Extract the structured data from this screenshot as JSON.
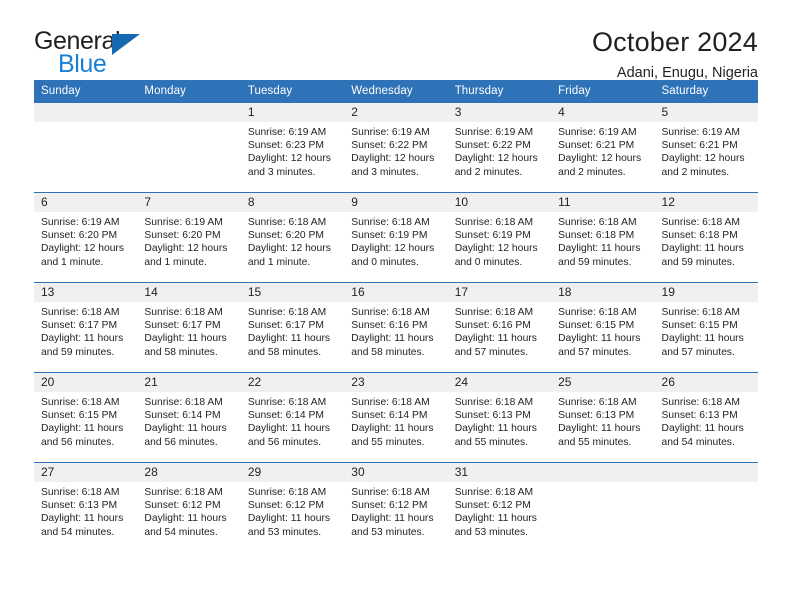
{
  "brand": {
    "name_top": "General",
    "name_bottom": "Blue",
    "triangle_color": "#1668B0",
    "blue_color": "#1B7FD4"
  },
  "header": {
    "title": "October 2024",
    "subtitle": "Adani, Enugu, Nigeria",
    "header_bg": "#2E72B8",
    "date_strip_bg": "#F0F0F0"
  },
  "weekday_headers": [
    "Sunday",
    "Monday",
    "Tuesday",
    "Wednesday",
    "Thursday",
    "Friday",
    "Saturday"
  ],
  "labels": {
    "sunrise_prefix": "Sunrise:",
    "sunset_prefix": "Sunset:",
    "daylight_prefix": "Daylight:"
  },
  "weeks": [
    [
      {
        "date": "",
        "line1": "",
        "line2": "",
        "line3": "",
        "line4": ""
      },
      {
        "date": "",
        "line1": "",
        "line2": "",
        "line3": "",
        "line4": ""
      },
      {
        "date": "1",
        "line1": "Sunrise: 6:19 AM",
        "line2": "Sunset: 6:23 PM",
        "line3": "Daylight: 12 hours",
        "line4": "and 3 minutes."
      },
      {
        "date": "2",
        "line1": "Sunrise: 6:19 AM",
        "line2": "Sunset: 6:22 PM",
        "line3": "Daylight: 12 hours",
        "line4": "and 3 minutes."
      },
      {
        "date": "3",
        "line1": "Sunrise: 6:19 AM",
        "line2": "Sunset: 6:22 PM",
        "line3": "Daylight: 12 hours",
        "line4": "and 2 minutes."
      },
      {
        "date": "4",
        "line1": "Sunrise: 6:19 AM",
        "line2": "Sunset: 6:21 PM",
        "line3": "Daylight: 12 hours",
        "line4": "and 2 minutes."
      },
      {
        "date": "5",
        "line1": "Sunrise: 6:19 AM",
        "line2": "Sunset: 6:21 PM",
        "line3": "Daylight: 12 hours",
        "line4": "and 2 minutes."
      }
    ],
    [
      {
        "date": "6",
        "line1": "Sunrise: 6:19 AM",
        "line2": "Sunset: 6:20 PM",
        "line3": "Daylight: 12 hours",
        "line4": "and 1 minute."
      },
      {
        "date": "7",
        "line1": "Sunrise: 6:19 AM",
        "line2": "Sunset: 6:20 PM",
        "line3": "Daylight: 12 hours",
        "line4": "and 1 minute."
      },
      {
        "date": "8",
        "line1": "Sunrise: 6:18 AM",
        "line2": "Sunset: 6:20 PM",
        "line3": "Daylight: 12 hours",
        "line4": "and 1 minute."
      },
      {
        "date": "9",
        "line1": "Sunrise: 6:18 AM",
        "line2": "Sunset: 6:19 PM",
        "line3": "Daylight: 12 hours",
        "line4": "and 0 minutes."
      },
      {
        "date": "10",
        "line1": "Sunrise: 6:18 AM",
        "line2": "Sunset: 6:19 PM",
        "line3": "Daylight: 12 hours",
        "line4": "and 0 minutes."
      },
      {
        "date": "11",
        "line1": "Sunrise: 6:18 AM",
        "line2": "Sunset: 6:18 PM",
        "line3": "Daylight: 11 hours",
        "line4": "and 59 minutes."
      },
      {
        "date": "12",
        "line1": "Sunrise: 6:18 AM",
        "line2": "Sunset: 6:18 PM",
        "line3": "Daylight: 11 hours",
        "line4": "and 59 minutes."
      }
    ],
    [
      {
        "date": "13",
        "line1": "Sunrise: 6:18 AM",
        "line2": "Sunset: 6:17 PM",
        "line3": "Daylight: 11 hours",
        "line4": "and 59 minutes."
      },
      {
        "date": "14",
        "line1": "Sunrise: 6:18 AM",
        "line2": "Sunset: 6:17 PM",
        "line3": "Daylight: 11 hours",
        "line4": "and 58 minutes."
      },
      {
        "date": "15",
        "line1": "Sunrise: 6:18 AM",
        "line2": "Sunset: 6:17 PM",
        "line3": "Daylight: 11 hours",
        "line4": "and 58 minutes."
      },
      {
        "date": "16",
        "line1": "Sunrise: 6:18 AM",
        "line2": "Sunset: 6:16 PM",
        "line3": "Daylight: 11 hours",
        "line4": "and 58 minutes."
      },
      {
        "date": "17",
        "line1": "Sunrise: 6:18 AM",
        "line2": "Sunset: 6:16 PM",
        "line3": "Daylight: 11 hours",
        "line4": "and 57 minutes."
      },
      {
        "date": "18",
        "line1": "Sunrise: 6:18 AM",
        "line2": "Sunset: 6:15 PM",
        "line3": "Daylight: 11 hours",
        "line4": "and 57 minutes."
      },
      {
        "date": "19",
        "line1": "Sunrise: 6:18 AM",
        "line2": "Sunset: 6:15 PM",
        "line3": "Daylight: 11 hours",
        "line4": "and 57 minutes."
      }
    ],
    [
      {
        "date": "20",
        "line1": "Sunrise: 6:18 AM",
        "line2": "Sunset: 6:15 PM",
        "line3": "Daylight: 11 hours",
        "line4": "and 56 minutes."
      },
      {
        "date": "21",
        "line1": "Sunrise: 6:18 AM",
        "line2": "Sunset: 6:14 PM",
        "line3": "Daylight: 11 hours",
        "line4": "and 56 minutes."
      },
      {
        "date": "22",
        "line1": "Sunrise: 6:18 AM",
        "line2": "Sunset: 6:14 PM",
        "line3": "Daylight: 11 hours",
        "line4": "and 56 minutes."
      },
      {
        "date": "23",
        "line1": "Sunrise: 6:18 AM",
        "line2": "Sunset: 6:14 PM",
        "line3": "Daylight: 11 hours",
        "line4": "and 55 minutes."
      },
      {
        "date": "24",
        "line1": "Sunrise: 6:18 AM",
        "line2": "Sunset: 6:13 PM",
        "line3": "Daylight: 11 hours",
        "line4": "and 55 minutes."
      },
      {
        "date": "25",
        "line1": "Sunrise: 6:18 AM",
        "line2": "Sunset: 6:13 PM",
        "line3": "Daylight: 11 hours",
        "line4": "and 55 minutes."
      },
      {
        "date": "26",
        "line1": "Sunrise: 6:18 AM",
        "line2": "Sunset: 6:13 PM",
        "line3": "Daylight: 11 hours",
        "line4": "and 54 minutes."
      }
    ],
    [
      {
        "date": "27",
        "line1": "Sunrise: 6:18 AM",
        "line2": "Sunset: 6:13 PM",
        "line3": "Daylight: 11 hours",
        "line4": "and 54 minutes."
      },
      {
        "date": "28",
        "line1": "Sunrise: 6:18 AM",
        "line2": "Sunset: 6:12 PM",
        "line3": "Daylight: 11 hours",
        "line4": "and 54 minutes."
      },
      {
        "date": "29",
        "line1": "Sunrise: 6:18 AM",
        "line2": "Sunset: 6:12 PM",
        "line3": "Daylight: 11 hours",
        "line4": "and 53 minutes."
      },
      {
        "date": "30",
        "line1": "Sunrise: 6:18 AM",
        "line2": "Sunset: 6:12 PM",
        "line3": "Daylight: 11 hours",
        "line4": "and 53 minutes."
      },
      {
        "date": "31",
        "line1": "Sunrise: 6:18 AM",
        "line2": "Sunset: 6:12 PM",
        "line3": "Daylight: 11 hours",
        "line4": "and 53 minutes."
      },
      {
        "date": "",
        "line1": "",
        "line2": "",
        "line3": "",
        "line4": ""
      },
      {
        "date": "",
        "line1": "",
        "line2": "",
        "line3": "",
        "line4": ""
      }
    ]
  ]
}
